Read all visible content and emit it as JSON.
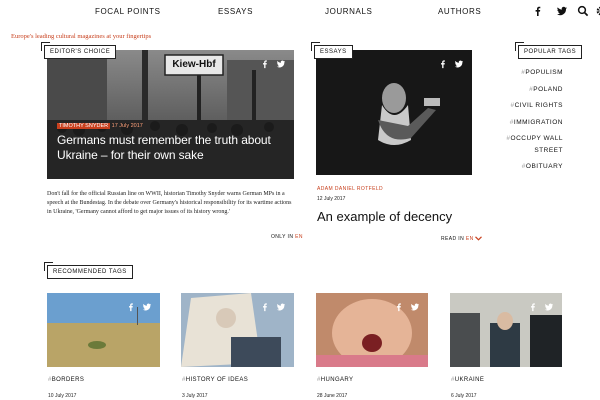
{
  "nav": {
    "items": [
      "FOCAL POINTS",
      "ESSAYS",
      "JOURNALS",
      "AUTHORS"
    ],
    "icons": [
      "facebook-icon",
      "twitter-icon",
      "search-icon",
      "settings-icon"
    ]
  },
  "tagline": "Europe's leading cultural magazines at your fingertips",
  "featured": {
    "label": "EDITOR'S CHOICE",
    "kicker": "TIMOTHY SNYDER",
    "date": "17 July 2017",
    "title": "Germans must remember the truth about Ukraine – for their own sake",
    "excerpt": "Don't fall for the official Russian line on WWII, historian Timothy Snyder warns German MPs in a speech at the Bundestag. In the debate over Germany's historical responsibility for its wartime actions in Ukraine, 'Germany cannot afford to get major issues of its history wrong.'",
    "sign_text": "Kiew-Hbf",
    "readmore_prefix": "ONLY IN",
    "readmore_lang": "EN"
  },
  "essay": {
    "label": "ESSAYS",
    "author": "ADAM DANIEL ROTFELD",
    "date": "12 July 2017",
    "title": "An example of decency",
    "readmore_prefix": "READ IN",
    "readmore_lang": "EN"
  },
  "popular_tags": {
    "label": "POPULAR TAGS",
    "hash": "#",
    "tags": [
      "POPULISM",
      "POLAND",
      "CIVIL RIGHTS",
      "IMMIGRATION",
      "OCCUPY WALL STREET",
      "OBITUARY"
    ]
  },
  "recommended": {
    "label": "RECOMMENDED TAGS",
    "cards": [
      {
        "tag": "BORDERS",
        "date": "10 July 2017"
      },
      {
        "tag": "HISTORY OF IDEAS",
        "date": "3 July 2017"
      },
      {
        "tag": "HUNGARY",
        "date": "28 June 2017"
      },
      {
        "tag": "UKRAINE",
        "date": "6 July 2017"
      }
    ]
  },
  "colors": {
    "accent": "#c8401e"
  }
}
